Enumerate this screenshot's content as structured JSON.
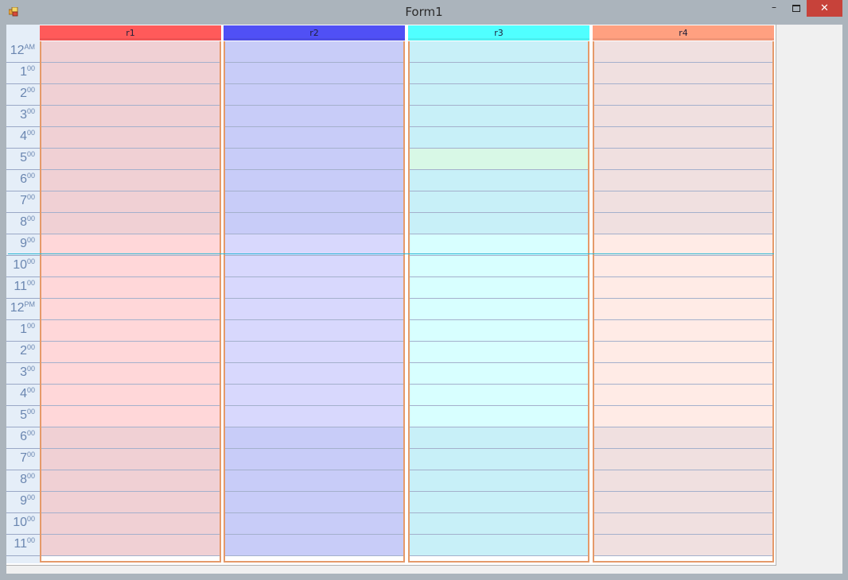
{
  "window": {
    "title": "Form1",
    "minimize_glyph": "–",
    "close_glyph": "✕",
    "icon": "winforms-app-icon"
  },
  "times": [
    {
      "h": "12",
      "m": "AM"
    },
    {
      "h": "1",
      "m": "00"
    },
    {
      "h": "2",
      "m": "00"
    },
    {
      "h": "3",
      "m": "00"
    },
    {
      "h": "4",
      "m": "00"
    },
    {
      "h": "5",
      "m": "00"
    },
    {
      "h": "6",
      "m": "00"
    },
    {
      "h": "7",
      "m": "00"
    },
    {
      "h": "8",
      "m": "00"
    },
    {
      "h": "9",
      "m": "00"
    },
    {
      "h": "10",
      "m": "00"
    },
    {
      "h": "11",
      "m": "00"
    },
    {
      "h": "12",
      "m": "PM"
    },
    {
      "h": "1",
      "m": "00"
    },
    {
      "h": "2",
      "m": "00"
    },
    {
      "h": "3",
      "m": "00"
    },
    {
      "h": "4",
      "m": "00"
    },
    {
      "h": "5",
      "m": "00"
    },
    {
      "h": "6",
      "m": "00"
    },
    {
      "h": "7",
      "m": "00"
    },
    {
      "h": "8",
      "m": "00"
    },
    {
      "h": "9",
      "m": "00"
    },
    {
      "h": "10",
      "m": "00"
    },
    {
      "h": "11",
      "m": "00"
    }
  ],
  "work_hours": {
    "start": 9,
    "end": 18
  },
  "now_hour": 10,
  "resources": [
    {
      "name": "r1",
      "header_color": "#ff5a5a",
      "off_color": "#f0d0d4",
      "work_color": "#ffd7d9",
      "highlight_slots": []
    },
    {
      "name": "r2",
      "header_color": "#5050f5",
      "off_color": "#c8ccf8",
      "work_color": "#d8d8fd",
      "highlight_slots": []
    },
    {
      "name": "r3",
      "header_color": "#50ffff",
      "off_color": "#c8f0f8",
      "work_color": "#d8ffff",
      "highlight_slots": [
        5
      ],
      "highlight_color": "#d8f8e6"
    },
    {
      "name": "r4",
      "header_color": "#ffa080",
      "off_color": "#f0e0e0",
      "work_color": "#ffebe6",
      "highlight_slots": []
    }
  ],
  "colors": {
    "time_text": "#6a86b0",
    "grid_line": "#a4b0cc",
    "column_border": "#e59a6a",
    "now_line": "#2fb8d6"
  }
}
